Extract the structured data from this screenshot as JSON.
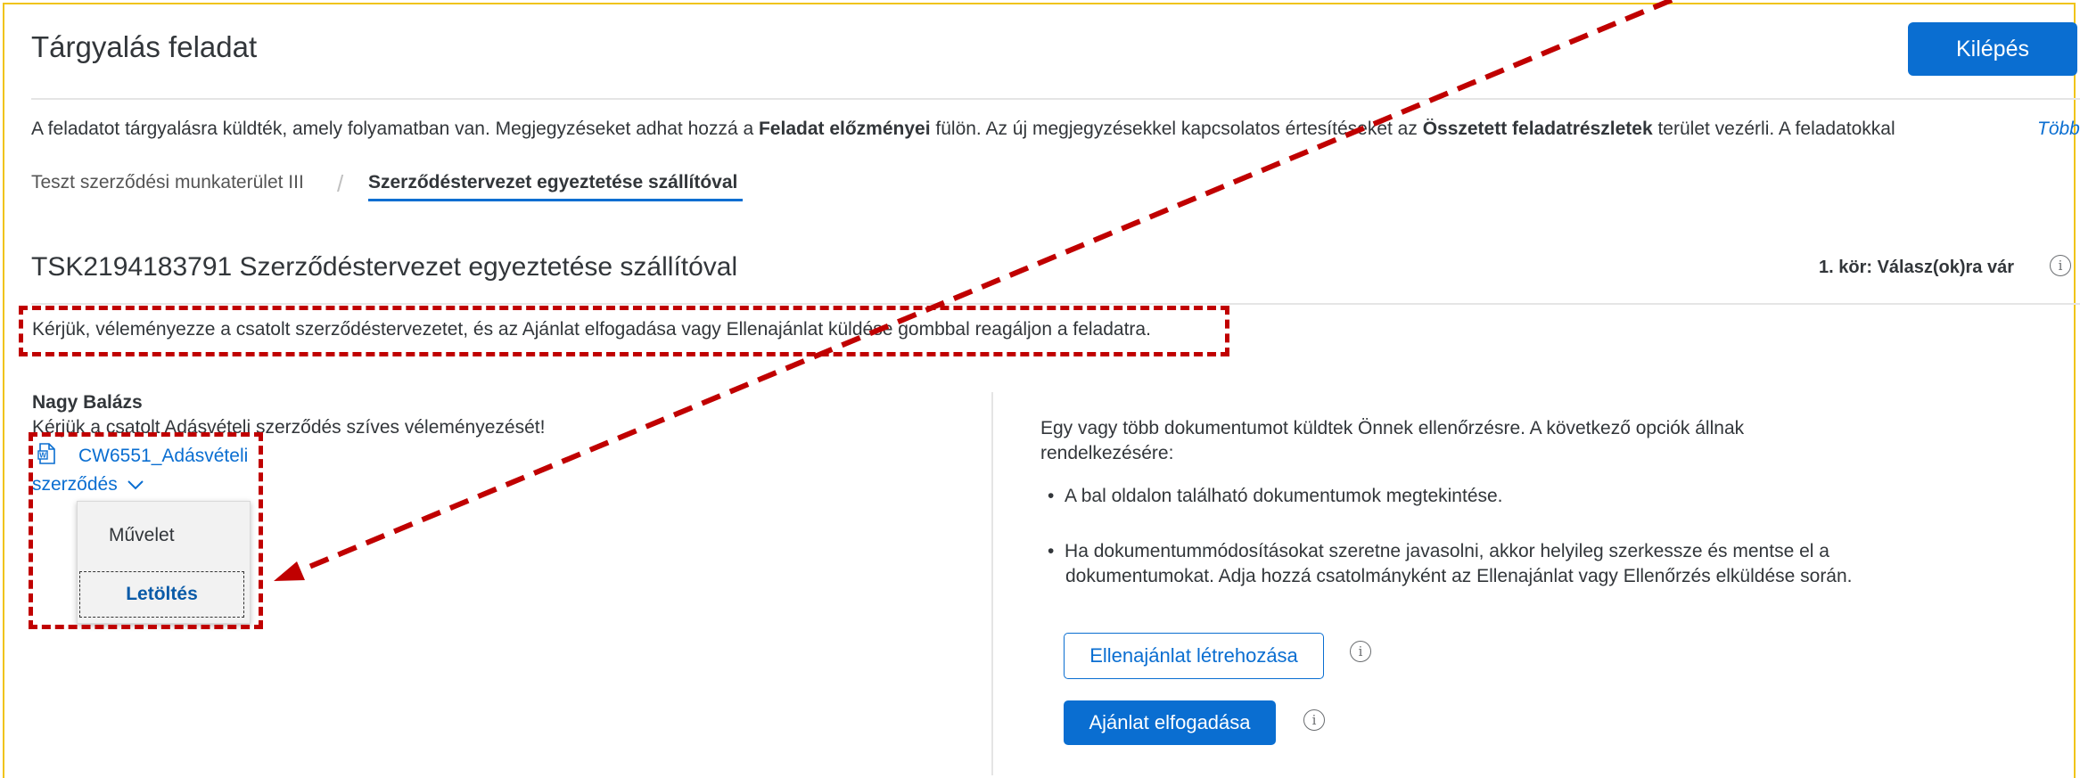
{
  "page": {
    "title": "Tárgyalás feladat",
    "exit_label": "Kilépés"
  },
  "info_bar": {
    "text_1": "A feladatot tárgyalásra küldték, amely folyamatban van. Megjegyzéseket adhat hozzá a ",
    "bold_1": "Feladat előzményei",
    "text_2": " fülön. Az új megjegyzésekkel kapcsolatos értesítéseket az ",
    "bold_2": "Összetett feladatrészletek",
    "text_3": " terület vezérli. A feladatokkal",
    "more_label": "Több"
  },
  "breadcrumb": {
    "parent": "Teszt szerződési munkaterület III",
    "separator": "/",
    "current": "Szerződéstervezet egyeztetése szállítóval"
  },
  "task": {
    "title": "TSK2194183791 Szerződéstervezet egyeztetése szállítóval",
    "round_status": "1. kör: Válasz(ok)ra vár",
    "instruction": "Kérjük, véleményezze a csatolt szerződéstervezetet, és az Ajánlat elfogadása vagy Ellenajánlat küldése gombbal reagáljon a feladatra."
  },
  "comment": {
    "author": "Nagy Balázs",
    "text": "Kérjük a csatolt Adásvételi szerződés szíves véleményezését!",
    "doc_name_line1": "CW6551_Adásvételi",
    "doc_name_line2": "szerződés",
    "menu_header": "Művelet",
    "menu_item": "Letöltés"
  },
  "right_panel": {
    "intro_line1": "Egy vagy több dokumentumot küldtek Önnek ellenőrzésre. A következő opciók állnak",
    "intro_line2": "rendelkezésére:",
    "bullet_1": "A bal oldalon található dokumentumok megtekintése.",
    "bullet_2_line1": "Ha dokumentummódosításokat szeretne javasolni, akkor helyileg szerkessze és mentse el a",
    "bullet_2_line2": "dokumentumokat. Adja hozzá csatolmányként az Ellenajánlat vagy Ellenőrzés elküldése során.",
    "counter_offer_label": "Ellenajánlat létrehozása",
    "accept_label": "Ajánlat elfogadása"
  },
  "colors": {
    "accent": "#0a6ed1",
    "annotation_red": "#c00000",
    "frame_border": "#f0c419"
  },
  "icons": {
    "info": "info-circle-icon",
    "document": "word-document-icon",
    "chevron": "chevron-down-icon"
  }
}
